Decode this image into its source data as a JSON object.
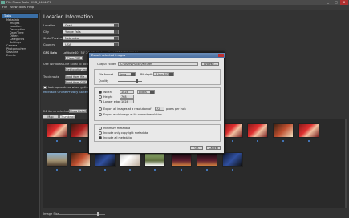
{
  "window": {
    "title": "Flin Photo Tools - IMG_5404.JPG",
    "min": "_",
    "max": "□",
    "close": "x"
  },
  "menu": [
    "File",
    "View",
    "Tools",
    "Help"
  ],
  "sidebar": {
    "root": "Tasks",
    "items": [
      {
        "label": "Metadata",
        "indent": 1
      },
      {
        "label": "Images",
        "indent": 2
      },
      {
        "label": "Location",
        "indent": 2
      },
      {
        "label": "Description",
        "indent": 2
      },
      {
        "label": "Date/Time",
        "indent": 2
      },
      {
        "label": "Others",
        "indent": 2
      },
      {
        "label": "Categories",
        "indent": 2
      },
      {
        "label": "Settings",
        "indent": 2
      },
      {
        "label": "Camera",
        "indent": 1
      },
      {
        "label": "Photographers",
        "indent": 1
      },
      {
        "label": "Sessions",
        "indent": 1
      },
      {
        "label": "Events",
        "indent": 1
      }
    ]
  },
  "location": {
    "heading": "Location Information",
    "fields": [
      {
        "label": "Location",
        "value": "Grad"
      },
      {
        "label": "City",
        "value": "Yonge Falls"
      },
      {
        "label": "State/Province",
        "value": "Nebraska"
      },
      {
        "label": "Country",
        "value": "USA"
      }
    ],
    "gps_label": "GPS Data",
    "lat_label": "Latitude",
    "lat_value": "40° 56' 26.07\" N",
    "lon_label": "Longitude",
    "lon_value": "98° 5' 59.46\" W",
    "clear_gps": "Clear GPS",
    "geo_note": "Use Windows Live Local to locate your image",
    "get_location": "Get location map",
    "track_label": "Track route",
    "load_from_file": "Load from file...",
    "load_from_gps": "Load from GPS...",
    "lookup_note": "look up address when getting location",
    "privacy": "Microsoft Online Privacy Statement"
  },
  "image_list": {
    "count_label": "24 items selected",
    "show_details": "Show Details",
    "tabs": [
      "Map Browser",
      "Thumbnails"
    ]
  },
  "zoom": {
    "label": "Image Size"
  },
  "dialog": {
    "title": "Export selected images",
    "output_label": "Output Folder",
    "output_value": "C:\\Users\\Public\\Pictures",
    "browse": "Browse...",
    "format_label": "File format",
    "format_value": "jpeg",
    "depth_label": "Bit depth",
    "depth_value": "8 bpc RGB",
    "quality_label": "Quality",
    "width_label": "Width",
    "width_value": "1024",
    "height_label": "Height",
    "height_value": "768",
    "longer_label": "Longer edge",
    "longer_value": "1024",
    "unit_value": "pixels",
    "resolution_note": "Export all images at a resolution of",
    "resolution_value": "72",
    "resolution_unit": "pixels per inch",
    "original_note": "Export each image at its current resolution",
    "meta_min": "Minimum metadata",
    "meta_copy": "Include only copyright metadata",
    "meta_all": "Include all metadata",
    "ok": "OK",
    "cancel": "Cancel"
  },
  "thumbnails": [
    {
      "c": "t-red"
    },
    {
      "c": "t-grad"
    },
    {
      "c": "t-people"
    },
    {
      "c": "t-red"
    },
    {
      "c": "t-red"
    },
    {
      "c": "t-red"
    },
    {
      "c": "t-grad"
    },
    {
      "c": "t-red"
    },
    {
      "c": "t-red"
    },
    {
      "c": "t-people"
    },
    {
      "c": "t-red"
    },
    {
      "c": "t-sky"
    },
    {
      "c": "t-people"
    },
    {
      "c": "t-dark"
    },
    {
      "c": "t-white"
    },
    {
      "c": "t-green"
    },
    {
      "c": "t-stage"
    },
    {
      "c": "t-stage"
    },
    {
      "c": "t-dark"
    }
  ]
}
